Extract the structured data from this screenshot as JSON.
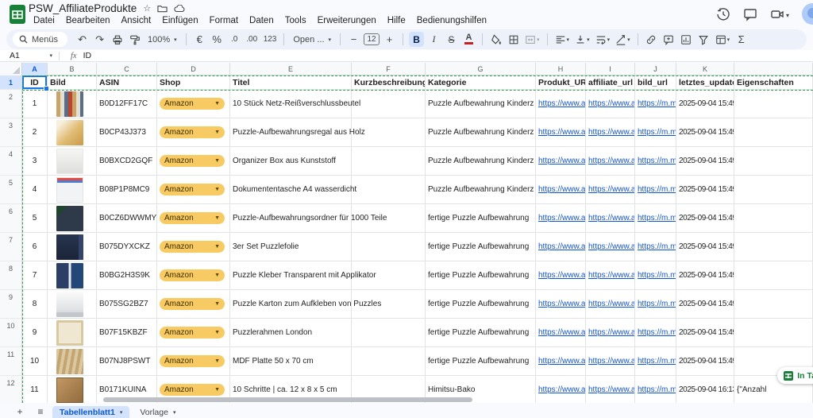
{
  "header": {
    "doc_title": "PSW_AffiliateProdukte",
    "menus": [
      "Datei",
      "Bearbeiten",
      "Ansicht",
      "Einfügen",
      "Format",
      "Daten",
      "Tools",
      "Erweiterungen",
      "Hilfe",
      "Bedienungshilfen"
    ]
  },
  "toolbar": {
    "search_label": "Menüs",
    "undo": "↶",
    "redo": "↷",
    "zoom": "100%",
    "euro": "€",
    "percent": "%",
    "decrease_decimal": ".0",
    "increase_decimal": ".00",
    "more_formats": "123",
    "font": "Open ...",
    "font_size": "12",
    "minus": "−",
    "plus": "+",
    "bold": "B",
    "italic": "I",
    "strikethrough": "S",
    "text_color": "A",
    "sigma": "Σ"
  },
  "formula_bar": {
    "cell_ref": "A1",
    "fx_label": "fx",
    "value": "ID"
  },
  "grid": {
    "column_letters": [
      "A",
      "B",
      "C",
      "D",
      "E",
      "F",
      "G",
      "H",
      "I",
      "J",
      "K",
      ""
    ],
    "header_row_num": "1",
    "headers": [
      "ID",
      "Bild",
      "ASIN",
      "Shop",
      "Titel",
      "Kurzbeschreibung",
      "Kategorie",
      "Produkt_URL",
      "affiliate_url",
      "bild_url",
      "letztes_update",
      "Eigenschaften"
    ],
    "rows": [
      {
        "num": "2",
        "id": "1",
        "thumb": "t1",
        "asin": "B0D12FF17C",
        "shop": "Amazon",
        "titel": "10 Stück Netz-Reißverschlussbeutel",
        "kurz": "",
        "kategorie": "Puzzle Aufbewahrung Kinderz",
        "produkt_url": "https://www.an",
        "affiliate_url": "https://www.a",
        "bild_url": "https://m.m",
        "update": "2025-09-04 15:49",
        "eigenschaften": ""
      },
      {
        "num": "3",
        "id": "2",
        "thumb": "t2",
        "asin": "B0CP43J373",
        "shop": "Amazon",
        "titel": "Puzzle-Aufbewahrungsregal aus Holz",
        "kurz": "",
        "kategorie": "Puzzle Aufbewahrung Kinderz",
        "produkt_url": "https://www.an",
        "affiliate_url": "https://www.a",
        "bild_url": "https://m.m",
        "update": "2025-09-04 15:49",
        "eigenschaften": ""
      },
      {
        "num": "4",
        "id": "3",
        "thumb": "t3",
        "asin": "B0BXCD2GQF",
        "shop": "Amazon",
        "titel": "Organizer Box aus Kunststoff",
        "kurz": "",
        "kategorie": "Puzzle Aufbewahrung Kinderz",
        "produkt_url": "https://www.an",
        "affiliate_url": "https://www.a",
        "bild_url": "https://m.m",
        "update": "2025-09-04 15:49",
        "eigenschaften": ""
      },
      {
        "num": "5",
        "id": "4",
        "thumb": "t4",
        "asin": "B08P1P8MC9",
        "shop": "Amazon",
        "titel": "Dokumententasche A4 wasserdicht",
        "kurz": "",
        "kategorie": "Puzzle Aufbewahrung Kinderz",
        "produkt_url": "https://www.an",
        "affiliate_url": "https://www.a",
        "bild_url": "https://m.m",
        "update": "2025-09-04 15:49",
        "eigenschaften": ""
      },
      {
        "num": "6",
        "id": "5",
        "thumb": "t5",
        "asin": "B0CZ6DWWMY",
        "shop": "Amazon",
        "titel": "Puzzle-Aufbewahrungsordner für 1000 Teile",
        "kurz": "",
        "kategorie": "fertige Puzzle Aufbewahrung",
        "produkt_url": "https://www.an",
        "affiliate_url": "https://www.a",
        "bild_url": "https://m.m",
        "update": "2025-09-04 15:49",
        "eigenschaften": ""
      },
      {
        "num": "7",
        "id": "6",
        "thumb": "t6",
        "asin": "B075DYXCKZ",
        "shop": "Amazon",
        "titel": "3er Set Puzzlefolie",
        "kurz": "",
        "kategorie": "fertige Puzzle Aufbewahrung",
        "produkt_url": "https://www.an",
        "affiliate_url": "https://www.a",
        "bild_url": "https://m.m",
        "update": "2025-09-04 15:49",
        "eigenschaften": ""
      },
      {
        "num": "8",
        "id": "7",
        "thumb": "t7",
        "asin": "B0BG2H3S9K",
        "shop": "Amazon",
        "titel": "Puzzle Kleber Transparent mit Applikator",
        "kurz": "",
        "kategorie": "fertige Puzzle Aufbewahrung",
        "produkt_url": "https://www.an",
        "affiliate_url": "https://www.a",
        "bild_url": "https://m.m",
        "update": "2025-09-04 15:49",
        "eigenschaften": ""
      },
      {
        "num": "9",
        "id": "8",
        "thumb": "t8",
        "asin": "B075SG2BZ7",
        "shop": "Amazon",
        "titel": "Puzzle Karton zum Aufkleben von Puzzles",
        "kurz": "",
        "kategorie": "fertige Puzzle Aufbewahrung",
        "produkt_url": "https://www.an",
        "affiliate_url": "https://www.a",
        "bild_url": "https://m.m",
        "update": "2025-09-04 15:49",
        "eigenschaften": ""
      },
      {
        "num": "10",
        "id": "9",
        "thumb": "t9",
        "asin": "B07F15KBZF",
        "shop": "Amazon",
        "titel": "Puzzlerahmen London",
        "kurz": "",
        "kategorie": "fertige Puzzle Aufbewahrung",
        "produkt_url": "https://www.an",
        "affiliate_url": "https://www.a",
        "bild_url": "https://m.m",
        "update": "2025-09-04 15:49",
        "eigenschaften": ""
      },
      {
        "num": "11",
        "id": "10",
        "thumb": "t10",
        "asin": "B07NJ8PSWT",
        "shop": "Amazon",
        "titel": "MDF Platte 50 x 70 cm",
        "kurz": "",
        "kategorie": "fertige Puzzle Aufbewahrung",
        "produkt_url": "https://www.an",
        "affiliate_url": "https://www.a",
        "bild_url": "https://m.m",
        "update": "2025-09-04 15:49",
        "eigenschaften": ""
      },
      {
        "num": "12",
        "id": "11",
        "thumb": "t11",
        "asin": "B0171KUINA",
        "shop": "Amazon",
        "titel": "10 Schritte | ca. 12 x 8 x 5 cm",
        "kurz": "",
        "kategorie": "Himitsu-Bako",
        "produkt_url": "https://www.an",
        "affiliate_url": "https://www.a",
        "bild_url": "https://m.m",
        "update": "2025-09-04 16:13",
        "eigenschaften": "{\"Anzahl"
      }
    ]
  },
  "sheet_tabs": {
    "add_label": "+",
    "all_sheets_label": "≡",
    "tabs": [
      {
        "label": "Tabellenblatt1",
        "active": true
      },
      {
        "label": "Vorlage",
        "active": false
      }
    ]
  },
  "toast": {
    "label": "In Tabell"
  },
  "colors": {
    "accent_blue": "#0b57d0",
    "chip_yellow": "#f8ca63",
    "link_blue": "#1155cc",
    "print_area_green": "#2e9e4f",
    "logo_green": "#188038"
  }
}
